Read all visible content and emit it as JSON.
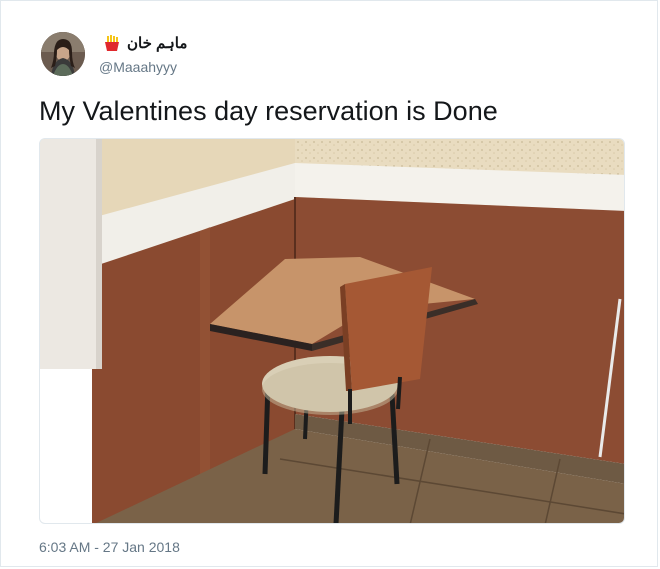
{
  "tweet": {
    "display_name": "ماہم خان",
    "name_emoji": "fries-icon",
    "handle": "@Maaahyyy",
    "text": "My Valentines day reservation is Done",
    "timestamp": "6:03 AM - 27 Jan 2018"
  },
  "colors": {
    "text_primary": "#14171a",
    "text_secondary": "#657786",
    "border": "#e1e8ed"
  }
}
